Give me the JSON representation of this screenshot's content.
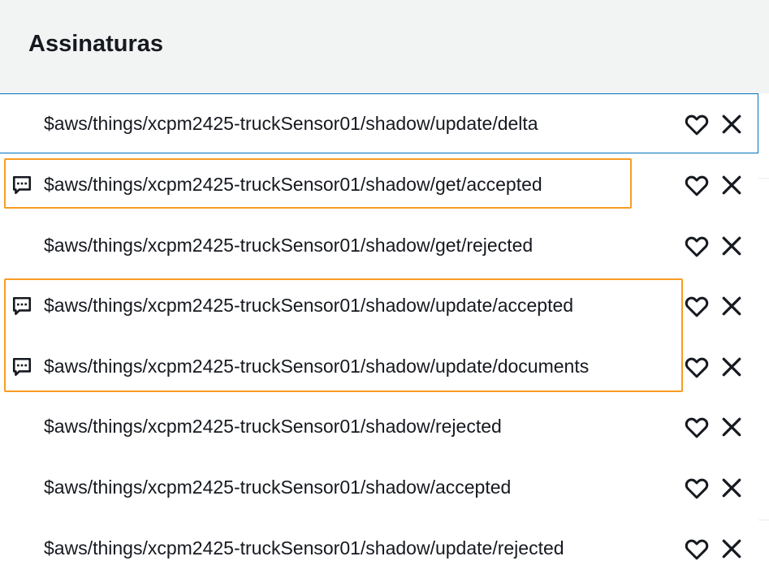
{
  "header": {
    "title": "Assinaturas"
  },
  "colors": {
    "header_bg": "#f2f3f3",
    "selected_border": "#0073bb",
    "highlight_border": "#f89c24",
    "text": "#16191f"
  },
  "subscriptions": [
    {
      "topic": "$aws/things/xcpm2425-truckSensor01/shadow/update/delta",
      "has_messages": false,
      "selected": true,
      "fav_icon": "heart-outline-icon",
      "remove_icon": "close-icon"
    },
    {
      "topic": "$aws/things/xcpm2425-truckSensor01/shadow/get/accepted",
      "has_messages": true,
      "selected": false,
      "fav_icon": "heart-outline-icon",
      "remove_icon": "close-icon"
    },
    {
      "topic": "$aws/things/xcpm2425-truckSensor01/shadow/get/rejected",
      "has_messages": false,
      "selected": false,
      "fav_icon": "heart-outline-icon",
      "remove_icon": "close-icon"
    },
    {
      "topic": "$aws/things/xcpm2425-truckSensor01/shadow/update/accepted",
      "has_messages": true,
      "selected": false,
      "fav_icon": "heart-outline-icon",
      "remove_icon": "close-icon"
    },
    {
      "topic": "$aws/things/xcpm2425-truckSensor01/shadow/update/documents",
      "has_messages": true,
      "selected": false,
      "fav_icon": "heart-outline-icon",
      "remove_icon": "close-icon"
    },
    {
      "topic": "$aws/things/xcpm2425-truckSensor01/shadow/rejected",
      "has_messages": false,
      "selected": false,
      "fav_icon": "heart-outline-icon",
      "remove_icon": "close-icon"
    },
    {
      "topic": "$aws/things/xcpm2425-truckSensor01/shadow/accepted",
      "has_messages": false,
      "selected": false,
      "fav_icon": "heart-outline-icon",
      "remove_icon": "close-icon"
    },
    {
      "topic": "$aws/things/xcpm2425-truckSensor01/shadow/update/rejected",
      "has_messages": false,
      "selected": false,
      "fav_icon": "heart-outline-icon",
      "remove_icon": "close-icon"
    }
  ]
}
